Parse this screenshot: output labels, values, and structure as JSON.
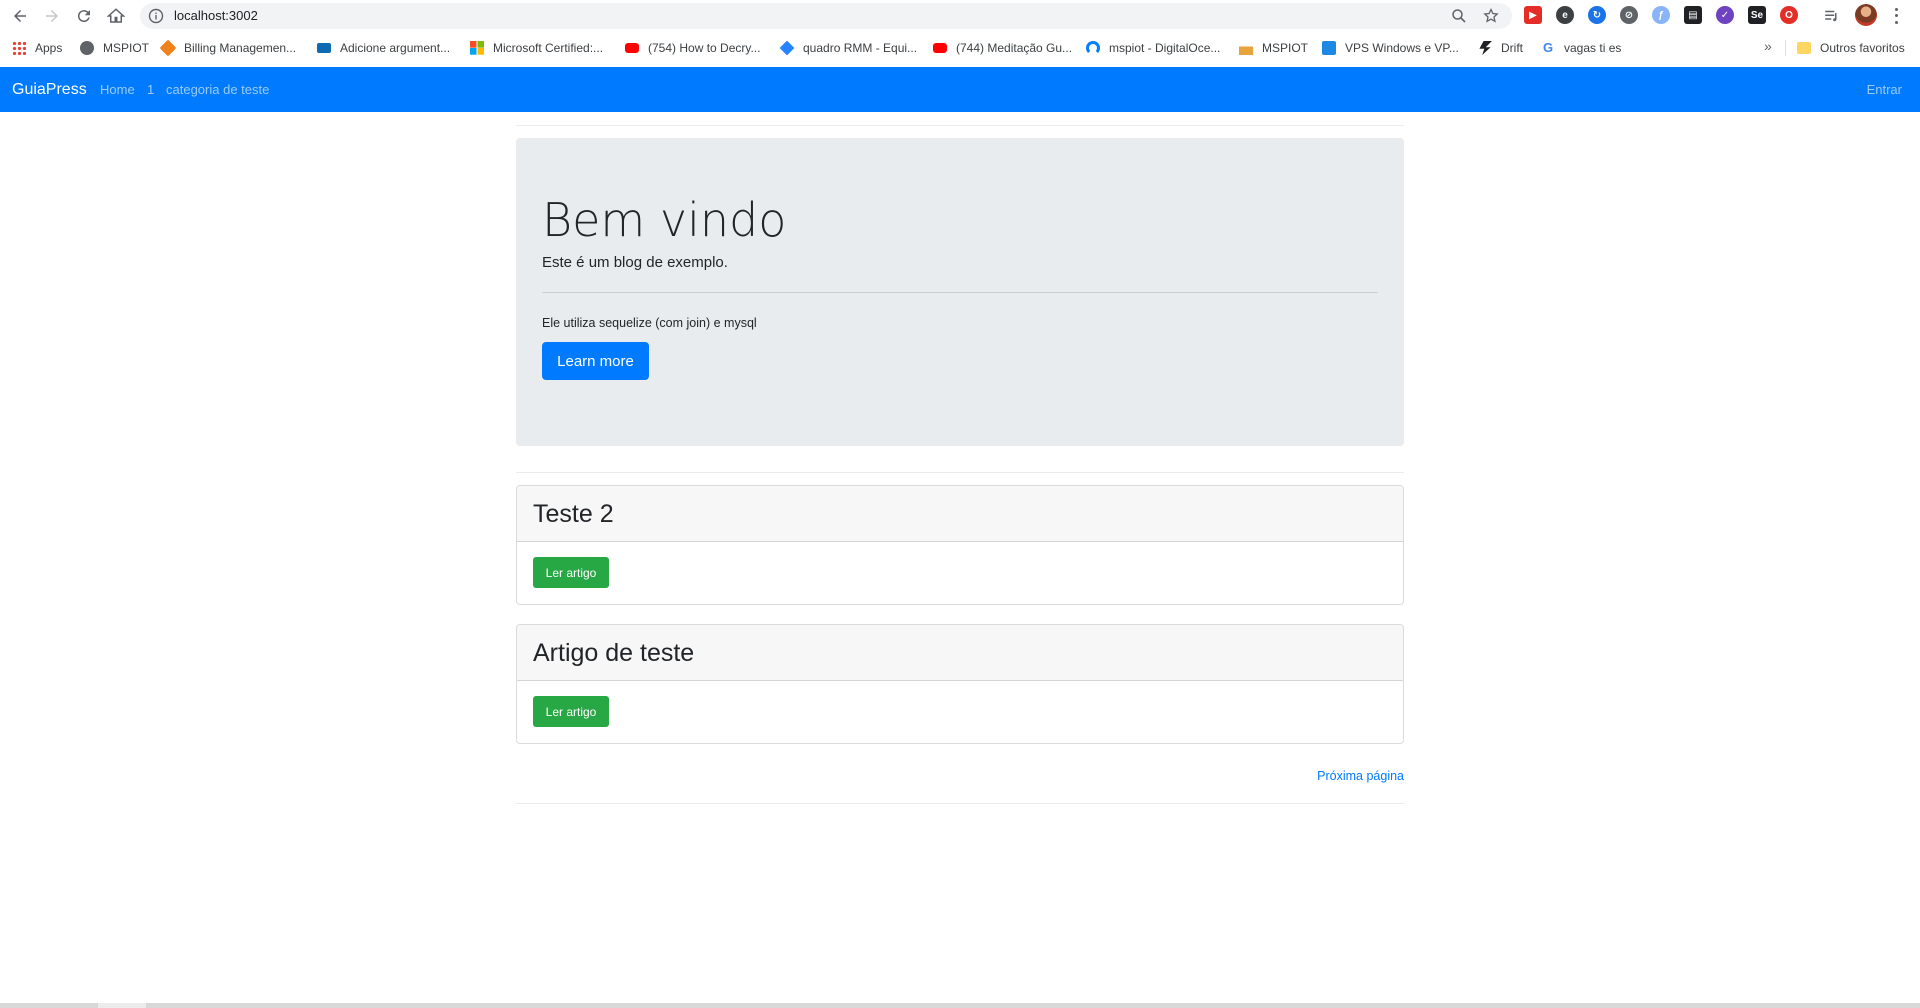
{
  "browser": {
    "url": "localhost:3002",
    "bookmarks": [
      {
        "label": "Apps",
        "icon": "apps-grid-icon"
      },
      {
        "label": "MSPIOT",
        "icon": "globe-icon"
      },
      {
        "label": "Billing Managemen...",
        "icon": "billing-icon"
      },
      {
        "label": "Adicione argument...",
        "icon": "video-icon"
      },
      {
        "label": "Microsoft Certified:...",
        "icon": "microsoft-icon"
      },
      {
        "label": "(754) How to Decry...",
        "icon": "youtube-icon"
      },
      {
        "label": "quadro RMM - Equi...",
        "icon": "jira-icon"
      },
      {
        "label": "(744) Meditação Gu...",
        "icon": "youtube-icon"
      },
      {
        "label": "mspiot - DigitalOce...",
        "icon": "digitalocean-icon"
      },
      {
        "label": "MSPIOT",
        "icon": "chart-icon"
      },
      {
        "label": "VPS Windows e VP...",
        "icon": "server-icon"
      },
      {
        "label": "Drift",
        "icon": "drift-icon"
      },
      {
        "label": "vagas ti es",
        "icon": "google-icon"
      }
    ],
    "other_bookmarks": "Outros favoritos",
    "colors": {
      "toolbar_bg": "#ffffff",
      "omnibox_bg": "#f1f3f4"
    }
  },
  "navbar": {
    "brand": "GuiaPress",
    "links": [
      "Home",
      "1",
      "categoria de teste"
    ],
    "login": "Entrar",
    "color": "#007bff"
  },
  "jumbotron": {
    "title": "Bem vindo",
    "lead": "Este é um blog de exemplo.",
    "text": "Ele utiliza sequelize (com join) e mysql",
    "button": "Learn more"
  },
  "articles": [
    {
      "title": "Teste 2",
      "button": "Ler artigo"
    },
    {
      "title": "Artigo de teste",
      "button": "Ler artigo"
    }
  ],
  "pagination": {
    "next": "Próxima página"
  }
}
